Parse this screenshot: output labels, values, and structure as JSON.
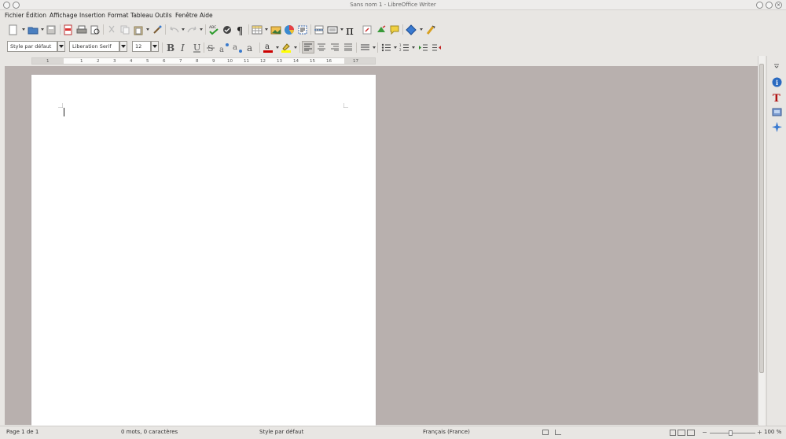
{
  "window": {
    "title": "Sans nom 1 - LibreOffice Writer"
  },
  "menu": [
    "Fichier",
    "Édition",
    "Affichage",
    "Insertion",
    "Format",
    "Tableau",
    "Outils",
    "Fenêtre",
    "Aide"
  ],
  "formatting": {
    "paragraph_style": "Style par défaut",
    "font_name": "Liberation Serif",
    "font_size": "12"
  },
  "ruler": {
    "ticks": [
      "1",
      "1",
      "2",
      "3",
      "4",
      "5",
      "6",
      "7",
      "8",
      "9",
      "10",
      "11",
      "12",
      "13",
      "14",
      "15",
      "16",
      "17"
    ]
  },
  "statusbar": {
    "page": "Page 1 de 1",
    "words": "0 mots, 0 caractères",
    "style": "Style par défaut",
    "language": "Français (France)",
    "zoom": "100 %"
  },
  "colors": {
    "canvas": "#b8b0ae",
    "page": "#ffffff",
    "chrome": "#e8e6e3"
  }
}
